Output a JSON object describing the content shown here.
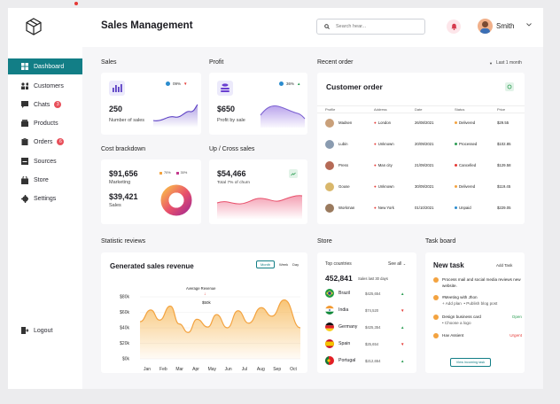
{
  "header": {
    "title": "Sales Management",
    "search_placeholder": "Search hear...",
    "user_name": "Smith"
  },
  "sidebar": {
    "items": [
      {
        "label": "Dashboard",
        "badge": ""
      },
      {
        "label": "Customers",
        "badge": ""
      },
      {
        "label": "Chats",
        "badge": "3"
      },
      {
        "label": "Products",
        "badge": ""
      },
      {
        "label": "Orders",
        "badge": "6"
      },
      {
        "label": "Sources",
        "badge": ""
      },
      {
        "label": "Store",
        "badge": ""
      },
      {
        "label": "Settings",
        "badge": ""
      }
    ],
    "logout": "Logout"
  },
  "sales": {
    "section": "Sales",
    "value": "250",
    "label": "Number of sales",
    "pct": "09%"
  },
  "profit": {
    "section": "Profit",
    "value": "$650",
    "label": "Profit by sale",
    "pct": "36%"
  },
  "cost": {
    "section": "Cost brackdown",
    "v1": "$91,656",
    "l1": "Marketing",
    "v2": "$39,421",
    "l2": "Sales",
    "leg1": "70%",
    "leg2": "30%"
  },
  "updown": {
    "section": "Up / Cross sales",
    "value": "$54,466",
    "label": "Total 7% of churn"
  },
  "recent": {
    "section": "Recent order",
    "filter": "Last 1 month",
    "title": "Customer order",
    "headers": [
      "Profile",
      "Address",
      "Date",
      "Status",
      "Price"
    ],
    "rows": [
      {
        "name": "Madsen",
        "addr": "London",
        "date": "26/08/2021",
        "status": "Delivered",
        "price": "$29.55"
      },
      {
        "name": "Lubin",
        "addr": "Unknown",
        "date": "20/09/2021",
        "status": "Processed",
        "price": "$102.85"
      },
      {
        "name": "Press",
        "addr": "Man city",
        "date": "21/09/2021",
        "status": "Cancelled",
        "price": "$129.58"
      },
      {
        "name": "Gouse",
        "addr": "Unknown",
        "date": "30/09/2021",
        "status": "Delivered",
        "price": "$119.45"
      },
      {
        "name": "Workman",
        "addr": "New York",
        "date": "01/10/2021",
        "status": "Unpaid",
        "price": "$229.05"
      }
    ]
  },
  "stat": {
    "section": "Statistic reviews",
    "title": "Generated sales revenue",
    "tabs": [
      "Month",
      "Week",
      "Day"
    ],
    "annot": "Average Revenue",
    "annot_val": "$50k"
  },
  "chart_data": {
    "type": "area",
    "title": "Generated sales revenue",
    "categories": [
      "Jan",
      "Feb",
      "Mar",
      "Apr",
      "May",
      "Jun",
      "Jul",
      "Aug",
      "Sep",
      "Oct"
    ],
    "ytick_labels": [
      "$80k",
      "$60k",
      "$40k",
      "$20k",
      "$0k"
    ],
    "ylim": [
      0,
      80
    ],
    "values": [
      48,
      63,
      50,
      68,
      45,
      34,
      51,
      41,
      57,
      40,
      62,
      46,
      66,
      55,
      76,
      40
    ],
    "x": [
      0.0,
      0.6,
      1.1,
      1.7,
      2.2,
      2.7,
      3.2,
      3.8,
      4.3,
      4.9,
      5.5,
      6.1,
      6.8,
      7.4,
      8.1,
      9.0
    ]
  },
  "store": {
    "section": "Store",
    "sub": "Top countries",
    "seeall": "See all",
    "total": "452,841",
    "total_label": "Sales last 30 days",
    "countries": [
      {
        "name": "Brazil",
        "amt": "$425,654",
        "dir": "up"
      },
      {
        "name": "India",
        "amt": "$74,520",
        "dir": "down"
      },
      {
        "name": "Germany",
        "amt": "$425,354",
        "dir": "up"
      },
      {
        "name": "Spain",
        "amt": "$25,654",
        "dir": "down"
      },
      {
        "name": "Portugal",
        "amt": "$212,654",
        "dir": "up"
      }
    ]
  },
  "task": {
    "section": "Task board",
    "title": "New task",
    "add": "Add Task",
    "t1": "Process mail and social media reviews new website.",
    "t2": "#Meeting with Jhon",
    "t2a": "+ Add plan",
    "t2b": "• Publish blog post",
    "t3": "Design business card",
    "t3s": "Open",
    "t3a": "• Choose a logo",
    "t4": "Hav Assient",
    "t4s": "Urgent",
    "btn": "View incoming task"
  },
  "colors": {
    "accent": "#127e86",
    "orange": "#f3a340",
    "purple": "#7b61d1",
    "pink": "#e8506b"
  }
}
